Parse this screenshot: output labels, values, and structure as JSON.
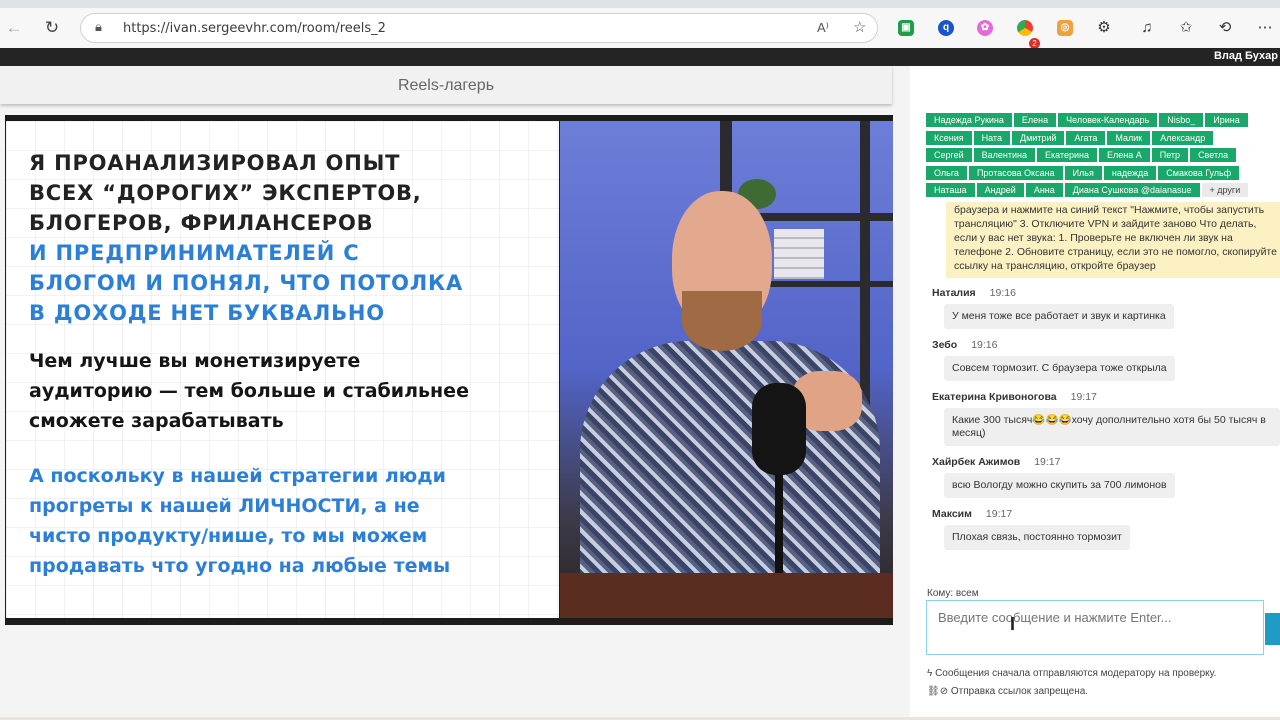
{
  "browser": {
    "url": "https://ivan.sergeevhr.com/room/reels_2",
    "icons": [
      "back-icon",
      "refresh-icon",
      "lock-icon",
      "read-aloud-icon",
      "favorite-star-icon",
      "extensions-icon",
      "favorites-icon",
      "history-icon"
    ]
  },
  "topbar": {
    "user": "Влад Бухар"
  },
  "room": {
    "title": "Reels-лагерь"
  },
  "slide": {
    "heading_dark": [
      "Я ПРОАНАЛИЗИРОВАЛ ОПЫТ",
      "ВСЕХ “ДОРОГИХ” ЭКСПЕРТОВ,",
      "БЛОГЕРОВ, ФРИЛАНСЕРОВ"
    ],
    "heading_blue": [
      "И ПРЕДПРИНИМАТЕЛЕЙ С",
      "БЛОГОМ И ПОНЯЛ, ЧТО ПОТОЛКА",
      "В ДОХОДЕ НЕТ БУКВАЛЬНО"
    ],
    "para_dark": [
      "Чем лучше вы монетизируете",
      "аудиторию — тем больше и стабильнее",
      "сможете зарабатывать"
    ],
    "para_blue": [
      "А поскольку в нашей стратегии люди",
      "прогреты к нашей ЛИЧНОСТИ, а не",
      "чисто продукту/нише, то мы можем",
      "продавать что угодно на любые темы"
    ]
  },
  "participants": {
    "rows": [
      [
        "Надежда Рукина",
        "Елена",
        "Человек-Календарь",
        "Nisbo_",
        "Ирина"
      ],
      [
        "Ксения",
        "Ната",
        "Дмитрий",
        "Агата",
        "Малик",
        "Александр"
      ],
      [
        "Сергей",
        "Валентина",
        "Екатерина",
        "Елена А",
        "Петр",
        "Светла"
      ],
      [
        "Ольга",
        "Протасова Оксана",
        "Илья",
        "надежда",
        "Смакова Гульф"
      ],
      [
        "Наташа",
        "Андрей",
        "Анна",
        "Диана Сушкова @daianasue"
      ]
    ],
    "more_label": "+ други"
  },
  "chat": {
    "notice": "браузера и нажмите на синий текст \"Нажмите, чтобы запустить трансляцию\" 3. Отключите VPN и зайдите заново Что делать, если у вас нет звука: 1. Проверьте не включен ли звук на телефоне 2. Обновите страницу, если это не помогло, скопируйте ссылку на трансляцию, откройте браузер",
    "messages": [
      {
        "name": "Наталия",
        "time": "19:16",
        "text": "У меня тоже все работает и звук и картинка"
      },
      {
        "name": "Зебо",
        "time": "19:16",
        "text": "Совсем тормозит. С браузера тоже открыла"
      },
      {
        "name": "Екатерина Кривоногова",
        "time": "19:17",
        "text": "Какие 300 тысяч😂😂😂хочу дополнительно хотя бы 50 тысяч в месяц)"
      },
      {
        "name": "Хайрбек Ажимов",
        "time": "19:17",
        "text": "всю Вологду можно скупить за 700 лимонов"
      },
      {
        "name": "Максим",
        "time": "19:17",
        "text": "Плохая связь, постоянно тормозит"
      }
    ],
    "recipient": "Кому: всем",
    "input_placeholder": "Введите сообщение и нажмите Enter...",
    "note_moderation": "Сообщения сначала отправляются модератору на проверку.",
    "note_links": "Отправка ссылок запрещена."
  }
}
